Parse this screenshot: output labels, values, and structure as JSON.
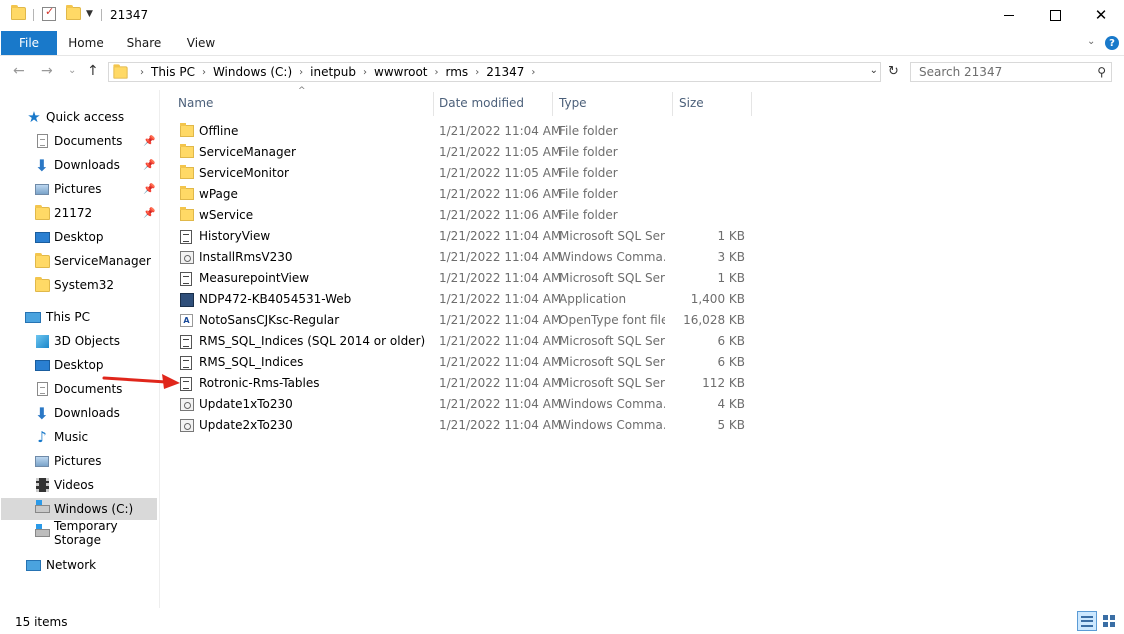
{
  "window": {
    "title": "21347",
    "minimize_icon": "minimize-icon",
    "maximize_icon": "maximize-icon",
    "close_icon": "close-icon"
  },
  "ribbon": {
    "tabs": [
      {
        "label": "File"
      },
      {
        "label": "Home"
      },
      {
        "label": "Share"
      },
      {
        "label": "View"
      }
    ],
    "accent": "#1979ca",
    "help": "?"
  },
  "address": {
    "crumbs": [
      "This PC",
      "Windows (C:)",
      "inetpub",
      "wwwroot",
      "rms",
      "21347"
    ]
  },
  "search": {
    "placeholder": "Search 21347"
  },
  "sidebar": {
    "quick_access": {
      "label": "Quick access",
      "items": [
        {
          "label": "Documents",
          "icon": "documents-icon",
          "pinned": true
        },
        {
          "label": "Downloads",
          "icon": "downloads-icon",
          "pinned": true
        },
        {
          "label": "Pictures",
          "icon": "pictures-icon",
          "pinned": true
        },
        {
          "label": "21172",
          "icon": "folder-icon",
          "pinned": true
        },
        {
          "label": "Desktop",
          "icon": "desktop-icon",
          "pinned": false
        },
        {
          "label": "ServiceManager",
          "icon": "folder-icon",
          "pinned": false
        },
        {
          "label": "System32",
          "icon": "folder-icon",
          "pinned": false
        }
      ]
    },
    "this_pc": {
      "label": "This PC",
      "items": [
        {
          "label": "3D Objects",
          "icon": "3d-objects-icon"
        },
        {
          "label": "Desktop",
          "icon": "desktop-icon"
        },
        {
          "label": "Documents",
          "icon": "documents-icon"
        },
        {
          "label": "Downloads",
          "icon": "downloads-icon"
        },
        {
          "label": "Music",
          "icon": "music-icon"
        },
        {
          "label": "Pictures",
          "icon": "pictures-icon"
        },
        {
          "label": "Videos",
          "icon": "videos-icon"
        },
        {
          "label": "Windows (C:)",
          "icon": "drive-icon",
          "selected": true
        },
        {
          "label": "Temporary Storage",
          "icon": "drive-icon"
        }
      ]
    },
    "network": {
      "label": "Network"
    }
  },
  "columns": {
    "name": "Name",
    "date": "Date modified",
    "type": "Type",
    "size": "Size"
  },
  "files": [
    {
      "name": "Offline",
      "date": "1/21/2022 11:04 AM",
      "type": "File folder",
      "size": "",
      "icon": "folder-icon"
    },
    {
      "name": "ServiceManager",
      "date": "1/21/2022 11:05 AM",
      "type": "File folder",
      "size": "",
      "icon": "folder-icon"
    },
    {
      "name": "ServiceMonitor",
      "date": "1/21/2022 11:05 AM",
      "type": "File folder",
      "size": "",
      "icon": "folder-icon"
    },
    {
      "name": "wPage",
      "date": "1/21/2022 11:06 AM",
      "type": "File folder",
      "size": "",
      "icon": "folder-icon"
    },
    {
      "name": "wService",
      "date": "1/21/2022 11:06 AM",
      "type": "File folder",
      "size": "",
      "icon": "folder-icon"
    },
    {
      "name": "HistoryView",
      "date": "1/21/2022 11:04 AM",
      "type": "Microsoft SQL Ser...",
      "size": "1 KB",
      "icon": "sql-file-icon"
    },
    {
      "name": "InstallRmsV230",
      "date": "1/21/2022 11:04 AM",
      "type": "Windows Comma...",
      "size": "3 KB",
      "icon": "cmd-file-icon"
    },
    {
      "name": "MeasurepointView",
      "date": "1/21/2022 11:04 AM",
      "type": "Microsoft SQL Ser...",
      "size": "1 KB",
      "icon": "sql-file-icon"
    },
    {
      "name": "NDP472-KB4054531-Web",
      "date": "1/21/2022 11:04 AM",
      "type": "Application",
      "size": "1,400 KB",
      "icon": "application-icon"
    },
    {
      "name": "NotoSansCJKsc-Regular",
      "date": "1/21/2022 11:04 AM",
      "type": "OpenType font file",
      "size": "16,028 KB",
      "icon": "font-file-icon"
    },
    {
      "name": "RMS_SQL_Indices (SQL 2014 or older)",
      "date": "1/21/2022 11:04 AM",
      "type": "Microsoft SQL Ser...",
      "size": "6 KB",
      "icon": "sql-file-icon"
    },
    {
      "name": "RMS_SQL_Indices",
      "date": "1/21/2022 11:04 AM",
      "type": "Microsoft SQL Ser...",
      "size": "6 KB",
      "icon": "sql-file-icon"
    },
    {
      "name": "Rotronic-Rms-Tables",
      "date": "1/21/2022 11:04 AM",
      "type": "Microsoft SQL Ser...",
      "size": "112 KB",
      "icon": "sql-file-icon"
    },
    {
      "name": "Update1xTo230",
      "date": "1/21/2022 11:04 AM",
      "type": "Windows Comma...",
      "size": "4 KB",
      "icon": "cmd-file-icon"
    },
    {
      "name": "Update2xTo230",
      "date": "1/21/2022 11:04 AM",
      "type": "Windows Comma...",
      "size": "5 KB",
      "icon": "cmd-file-icon"
    }
  ],
  "annotation": {
    "arrow_color": "#e0261b",
    "points_to": "Rotronic-Rms-Tables"
  },
  "status": {
    "count": "15 items"
  }
}
